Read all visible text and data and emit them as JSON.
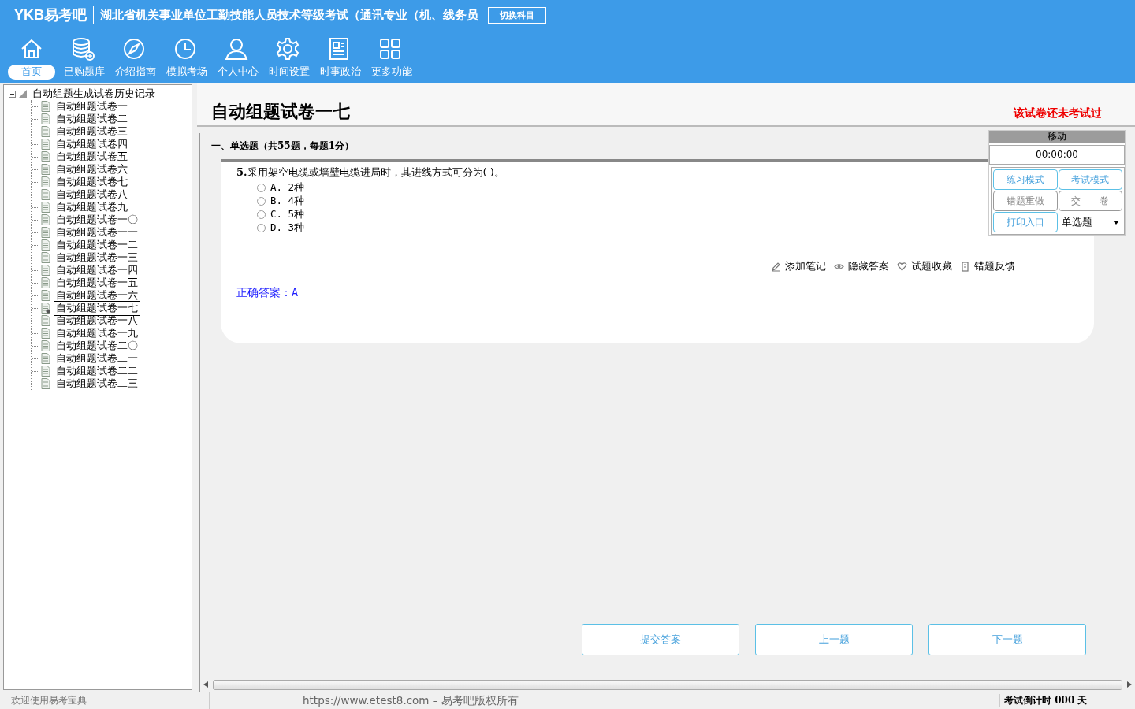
{
  "header": {
    "logo": "YKB易考吧",
    "title": "湖北省机关事业单位工勤技能人员技术等级考试（通讯专业（机、线务员",
    "switch_button": "切换科目"
  },
  "nav": [
    {
      "label": "首页",
      "kind": "home",
      "selected": true
    },
    {
      "label": "已购题库",
      "kind": "database",
      "selected": false
    },
    {
      "label": "介绍指南",
      "kind": "compass",
      "selected": false
    },
    {
      "label": "模拟考场",
      "kind": "clock",
      "selected": false
    },
    {
      "label": "个人中心",
      "kind": "user",
      "selected": false
    },
    {
      "label": "时间设置",
      "kind": "gear",
      "selected": false
    },
    {
      "label": "时事政治",
      "kind": "news",
      "selected": false
    },
    {
      "label": "更多功能",
      "kind": "grid",
      "selected": false
    }
  ],
  "tree": {
    "label": "自动组题生成试卷历史记录",
    "expanded": true,
    "children": [
      {
        "label": "自动组题试卷一",
        "selected": false
      },
      {
        "label": "自动组题试卷二",
        "selected": false
      },
      {
        "label": "自动组题试卷三",
        "selected": false
      },
      {
        "label": "自动组题试卷四",
        "selected": false
      },
      {
        "label": "自动组题试卷五",
        "selected": false
      },
      {
        "label": "自动组题试卷六",
        "selected": false
      },
      {
        "label": "自动组题试卷七",
        "selected": false
      },
      {
        "label": "自动组题试卷八",
        "selected": false
      },
      {
        "label": "自动组题试卷九",
        "selected": false
      },
      {
        "label": "自动组题试卷一〇",
        "selected": false
      },
      {
        "label": "自动组题试卷一一",
        "selected": false
      },
      {
        "label": "自动组题试卷一二",
        "selected": false
      },
      {
        "label": "自动组题试卷一三",
        "selected": false
      },
      {
        "label": "自动组题试卷一四",
        "selected": false
      },
      {
        "label": "自动组题试卷一五",
        "selected": false
      },
      {
        "label": "自动组题试卷一六",
        "selected": false
      },
      {
        "label": "自动组题试卷一七",
        "selected": true
      },
      {
        "label": "自动组题试卷一八",
        "selected": false
      },
      {
        "label": "自动组题试卷一九",
        "selected": false
      },
      {
        "label": "自动组题试卷二〇",
        "selected": false
      },
      {
        "label": "自动组题试卷二一",
        "selected": false
      },
      {
        "label": "自动组题试卷二二",
        "selected": false
      },
      {
        "label": "自动组题试卷二三",
        "selected": false
      }
    ]
  },
  "paper": {
    "title": "自动组题试卷一七",
    "status": "该试卷还未考试过"
  },
  "section": "一、单选题（共55题，每题1分）",
  "question": {
    "number": "5.",
    "text": "采用架空电缆或墙壁电缆进局时，其进线方式可分为( )。",
    "options": [
      {
        "label": "A. 2种",
        "selected": false
      },
      {
        "label": "B. 4种",
        "selected": false
      },
      {
        "label": "C. 5种",
        "selected": false
      },
      {
        "label": "D. 3种",
        "selected": false
      }
    ],
    "tools": [
      {
        "label": "添加笔记",
        "kind": "note"
      },
      {
        "label": "隐藏答案",
        "kind": "hide"
      },
      {
        "label": "试题收藏",
        "kind": "favorite"
      },
      {
        "label": "错题反馈",
        "kind": "feedback"
      }
    ],
    "answer": "正确答案：A"
  },
  "side_panel": {
    "header": "移动",
    "timer": "00:00:00",
    "buttons": [
      {
        "label": "练习模式",
        "kind": "accent"
      },
      {
        "label": "考试模式",
        "kind": "accent"
      },
      {
        "label": "错题重做",
        "kind": "plain"
      },
      {
        "label": "交　　卷",
        "kind": "plain"
      },
      {
        "label": "打印入口",
        "kind": "accent"
      }
    ],
    "dropdown": "单选题"
  },
  "bottom_buttons": [
    "提交答案",
    "上一题",
    "下一题"
  ],
  "status_bar": {
    "welcome": "欢迎使用易考宝典",
    "copyright": "https://www.etest8.com – 易考吧版权所有",
    "countdown": "考试倒计时 000 天"
  }
}
